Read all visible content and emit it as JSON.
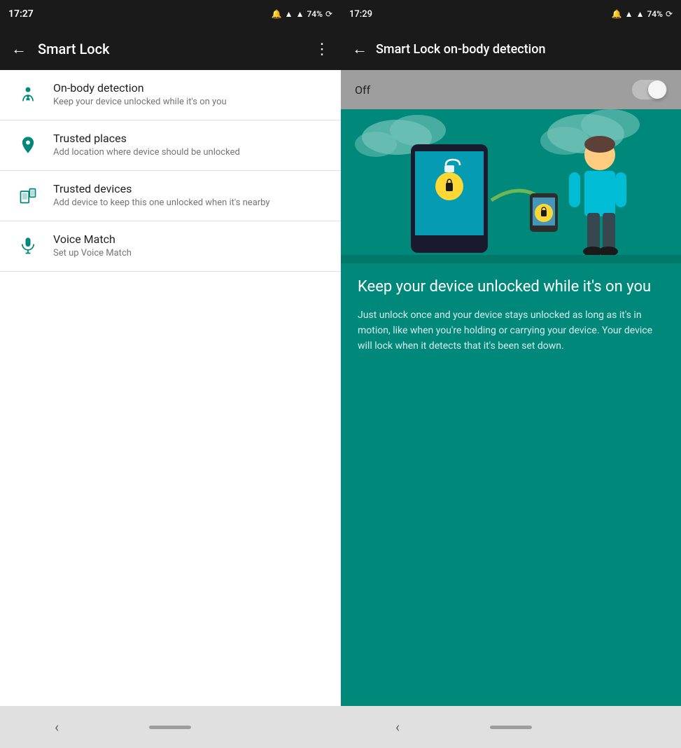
{
  "left": {
    "status_bar": {
      "time": "17:27",
      "icons": "🔔 ▲ 74% ⟳"
    },
    "top_bar": {
      "title": "Smart Lock",
      "back_label": "back",
      "more_label": "more"
    },
    "menu_items": [
      {
        "id": "on-body",
        "title": "On-body detection",
        "subtitle": "Keep your device unlocked while it's on you",
        "icon": "person"
      },
      {
        "id": "trusted-places",
        "title": "Trusted places",
        "subtitle": "Add location where device should be unlocked",
        "icon": "pin"
      },
      {
        "id": "trusted-devices",
        "title": "Trusted devices",
        "subtitle": "Add device to keep this one unlocked when it's nearby",
        "icon": "devices"
      },
      {
        "id": "voice-match",
        "title": "Voice Match",
        "subtitle": "Set up Voice Match",
        "icon": "mic"
      }
    ],
    "bottom_nav": {
      "back_chevron": "‹",
      "pill": ""
    }
  },
  "right": {
    "status_bar": {
      "time": "17:29",
      "icons": "🔔 ▲ 74% ⟳"
    },
    "top_bar": {
      "title": "Smart Lock on-body detection",
      "back_label": "back"
    },
    "toggle": {
      "label": "Off",
      "state": false
    },
    "content": {
      "heading": "Keep your device unlocked while it's on you",
      "body": "Just unlock once and your device stays unlocked as long as it's in motion, like when you're holding or carrying your device. Your device will lock when it detects that it's been set down."
    },
    "bottom_nav": {
      "back_chevron": "‹",
      "pill": ""
    }
  }
}
